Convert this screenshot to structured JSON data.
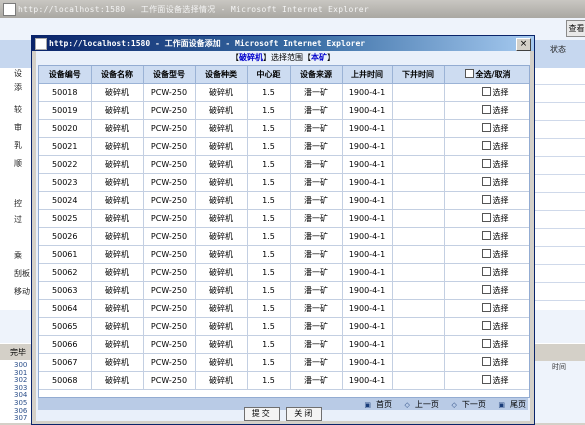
{
  "background": {
    "title": "http://localhost:1580 - 工作面设备选择情况 - Microsoft Internet Explorer",
    "check_button": "查看",
    "status_column": "状态",
    "left_labels": [
      "设",
      "添",
      "较",
      "审",
      "乳",
      "顺",
      "控",
      "过",
      "乘",
      "刮板",
      "移动"
    ],
    "status_text": "完毕",
    "line_numbers": [
      "300",
      "301",
      "302",
      "303",
      "304",
      "305",
      "306",
      "307"
    ],
    "time_fragment": "时间"
  },
  "dialog": {
    "title": "http://localhost:1580 - 工作面设备添加 - Microsoft Internet Explorer",
    "close_label": "×",
    "scope": {
      "category": "破碎机",
      "label": "选择范围",
      "mine": "本矿"
    },
    "table": {
      "headers": [
        "设备编号",
        "设备名称",
        "设备型号",
        "设备种类",
        "中心距",
        "设备来源",
        "上井时间",
        "下井时间",
        "全选/取消"
      ],
      "rows": [
        [
          "50018",
          "破碎机",
          "PCW-250",
          "破碎机",
          "1.5",
          "潘一矿",
          "1900-4-1",
          "",
          "选择"
        ],
        [
          "50019",
          "破碎机",
          "PCW-250",
          "破碎机",
          "1.5",
          "潘一矿",
          "1900-4-1",
          "",
          "选择"
        ],
        [
          "50020",
          "破碎机",
          "PCW-250",
          "破碎机",
          "1.5",
          "潘一矿",
          "1900-4-1",
          "",
          "选择"
        ],
        [
          "50021",
          "破碎机",
          "PCW-250",
          "破碎机",
          "1.5",
          "潘一矿",
          "1900-4-1",
          "",
          "选择"
        ],
        [
          "50022",
          "破碎机",
          "PCW-250",
          "破碎机",
          "1.5",
          "潘一矿",
          "1900-4-1",
          "",
          "选择"
        ],
        [
          "50023",
          "破碎机",
          "PCW-250",
          "破碎机",
          "1.5",
          "潘一矿",
          "1900-4-1",
          "",
          "选择"
        ],
        [
          "50024",
          "破碎机",
          "PCW-250",
          "破碎机",
          "1.5",
          "潘一矿",
          "1900-4-1",
          "",
          "选择"
        ],
        [
          "50025",
          "破碎机",
          "PCW-250",
          "破碎机",
          "1.5",
          "潘一矿",
          "1900-4-1",
          "",
          "选择"
        ],
        [
          "50026",
          "破碎机",
          "PCW-250",
          "破碎机",
          "1.5",
          "潘一矿",
          "1900-4-1",
          "",
          "选择"
        ],
        [
          "50061",
          "破碎机",
          "PCW-250",
          "破碎机",
          "1.5",
          "潘一矿",
          "1900-4-1",
          "",
          "选择"
        ],
        [
          "50062",
          "破碎机",
          "PCW-250",
          "破碎机",
          "1.5",
          "潘一矿",
          "1900-4-1",
          "",
          "选择"
        ],
        [
          "50063",
          "破碎机",
          "PCW-250",
          "破碎机",
          "1.5",
          "潘一矿",
          "1900-4-1",
          "",
          "选择"
        ],
        [
          "50064",
          "破碎机",
          "PCW-250",
          "破碎机",
          "1.5",
          "潘一矿",
          "1900-4-1",
          "",
          "选择"
        ],
        [
          "50065",
          "破碎机",
          "PCW-250",
          "破碎机",
          "1.5",
          "潘一矿",
          "1900-4-1",
          "",
          "选择"
        ],
        [
          "50066",
          "破碎机",
          "PCW-250",
          "破碎机",
          "1.5",
          "潘一矿",
          "1900-4-1",
          "",
          "选择"
        ],
        [
          "50067",
          "破碎机",
          "PCW-250",
          "破碎机",
          "1.5",
          "潘一矿",
          "1900-4-1",
          "",
          "选择"
        ],
        [
          "50068",
          "破碎机",
          "PCW-250",
          "破碎机",
          "1.5",
          "潘一矿",
          "1900-4-1",
          "",
          "选择"
        ]
      ]
    },
    "pager": {
      "first": "首页",
      "prev": "上一页",
      "next": "下一页",
      "last": "尾页"
    },
    "buttons": {
      "submit": "提交",
      "close": "关闭"
    }
  }
}
